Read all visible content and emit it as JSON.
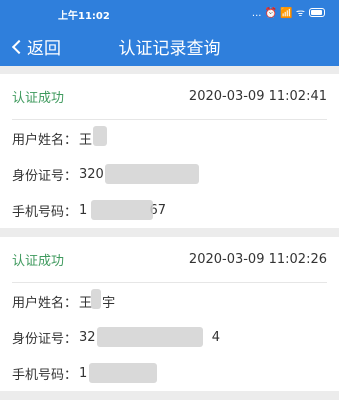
{
  "statusbar": {
    "time": "上午11:02",
    "icons": "...  ⏰ 📶 ᯤ"
  },
  "nav": {
    "back_label": "返回",
    "title": "认证记录查询"
  },
  "records": [
    {
      "status": "认证成功",
      "timestamp": "2020-03-09 11:02:41",
      "name_label": "用户姓名：",
      "name_value": "王",
      "id_label": "身份证号：",
      "id_value": "320",
      "phone_label": "手机号码：",
      "phone_value": "1",
      "phone_tail": "67"
    },
    {
      "status": "认证成功",
      "timestamp": "2020-03-09 11:02:26",
      "name_label": "用户姓名：",
      "name_value": "王",
      "name_tail": "宇",
      "id_label": "身份证号：",
      "id_value": "32",
      "id_tail": "4",
      "phone_label": "手机号码：",
      "phone_value": "1",
      "phone_tail": ""
    }
  ]
}
